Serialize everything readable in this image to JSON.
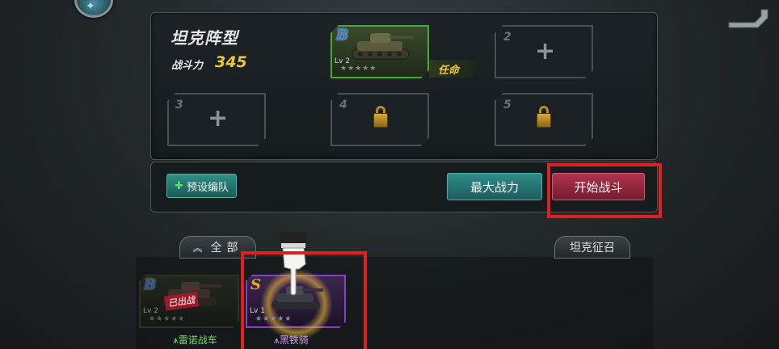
{
  "panel": {
    "title": "坦克阵型",
    "power_label": "战斗力",
    "power_value": "345"
  },
  "slots": [
    {
      "num": "",
      "grade": "B",
      "level": "Lv 2",
      "stars": "★★★★★",
      "tag": "任命",
      "state": "equipped"
    },
    {
      "num": "2",
      "state": "empty"
    },
    {
      "num": "3",
      "state": "empty"
    },
    {
      "num": "4",
      "state": "locked"
    },
    {
      "num": "5",
      "state": "locked"
    }
  ],
  "buttons": {
    "preset": "预设编队",
    "preset_icon": "plus-icon",
    "max_power": "最大战力",
    "start_battle": "开始战斗"
  },
  "tabs": {
    "all": "全部",
    "all_icon": "double-chevron-up-icon",
    "summon": "坦克征召"
  },
  "tank_list": [
    {
      "grade": "B",
      "level": "Lv 2",
      "stars": "★★★★★",
      "status": "已出战",
      "name": "雷诺战车",
      "name_color": "#7fd86d"
    },
    {
      "grade": "S",
      "level": "Lv 1",
      "stars": "★★★★★",
      "status": "",
      "name": "黑铁骑",
      "name_color": "#c79be8"
    }
  ],
  "colors": {
    "accent_gold": "#f0c535",
    "start_red": "#b0334d",
    "teal": "#2f8d8a",
    "highlight": "#e02020"
  }
}
